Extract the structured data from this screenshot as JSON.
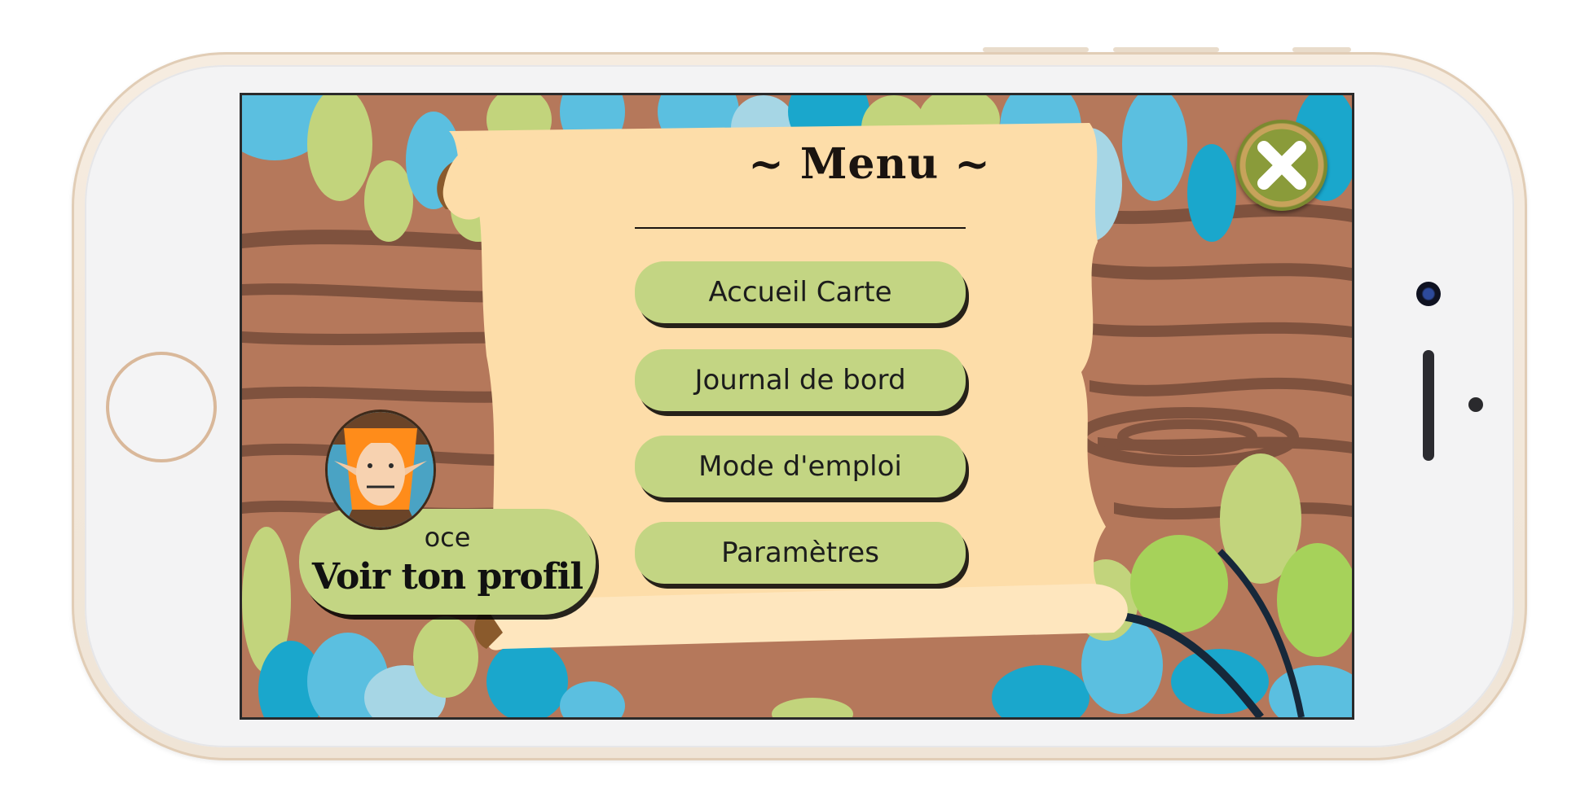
{
  "menu": {
    "title": "~ Menu ~",
    "items": [
      {
        "label": "Accueil Carte"
      },
      {
        "label": "Journal de bord"
      },
      {
        "label": "Mode d'emploi"
      },
      {
        "label": "Paramètres"
      }
    ]
  },
  "profile": {
    "username": "oce",
    "link_label": "Voir ton profil"
  },
  "icons": {
    "close": "close-icon",
    "home": "home-button",
    "avatar": "avatar-icon"
  },
  "colors": {
    "button_green": "#c3d583",
    "parchment": "#fddda9",
    "wood": "#b5785b",
    "leaf_blue": "#5bbfe0",
    "leaf_green": "#c2d47c"
  }
}
